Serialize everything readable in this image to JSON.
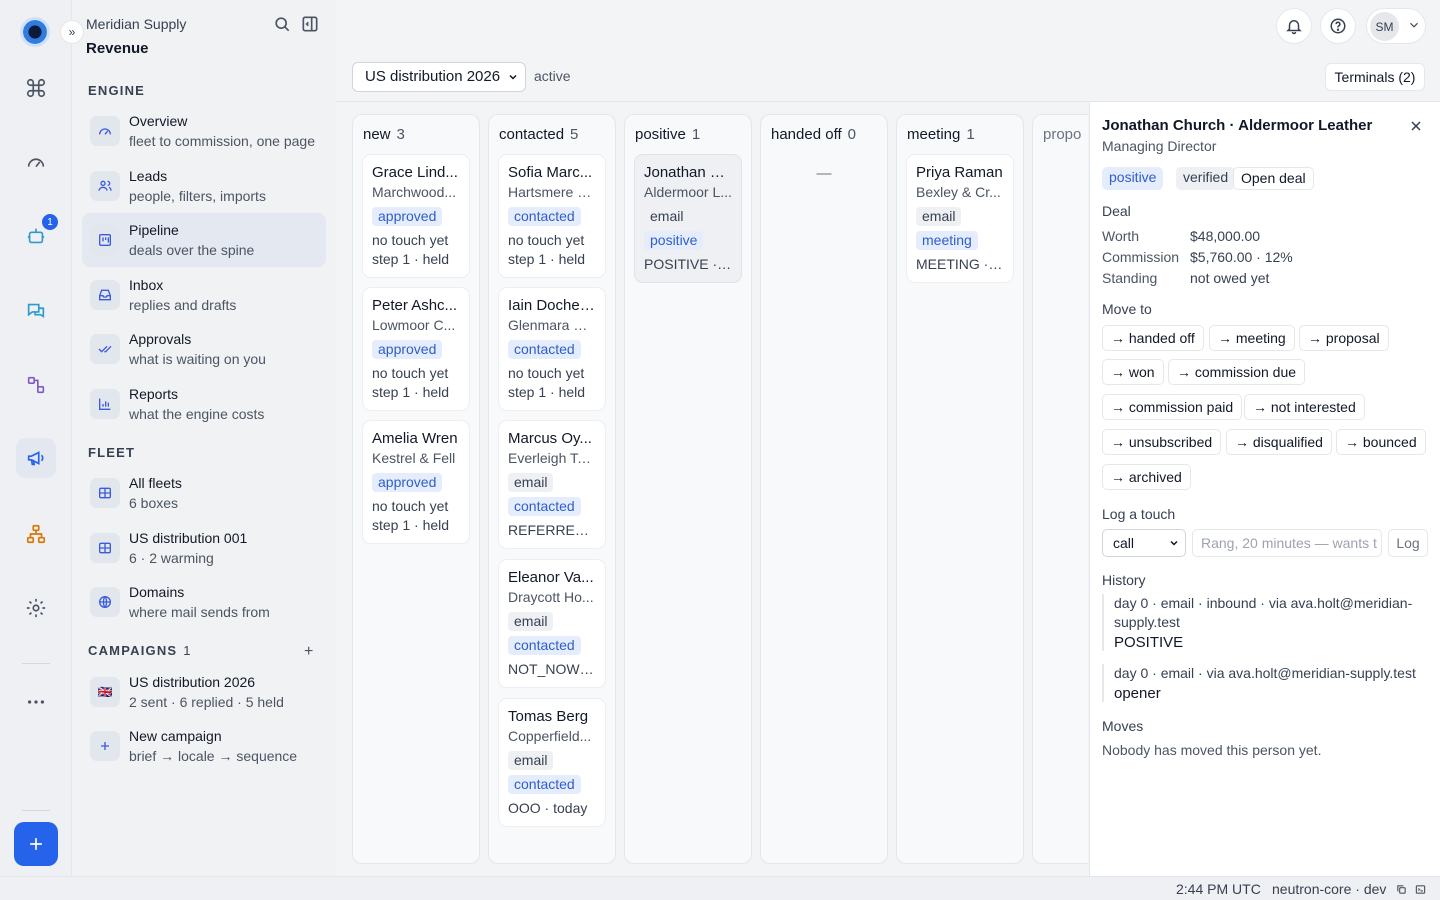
{
  "rail": {
    "inbox_badge": "1",
    "icons": [
      "command-icon",
      "gauge-icon",
      "bot-icon",
      "chat-icon",
      "flow-icon",
      "megaphone-icon",
      "org-chart-icon",
      "gear-icon",
      "more-icon"
    ]
  },
  "sidebar": {
    "org_name": "Meridian Supply",
    "section_title": "Revenue",
    "engine_heading": "ENGINE",
    "engine_items": [
      {
        "title": "Overview",
        "subtitle": "fleet to commission, one page"
      },
      {
        "title": "Leads",
        "subtitle": "people, filters, imports"
      },
      {
        "title": "Pipeline",
        "subtitle": "deals over the spine"
      },
      {
        "title": "Inbox",
        "subtitle": "replies and drafts"
      },
      {
        "title": "Approvals",
        "subtitle": "what is waiting on you"
      },
      {
        "title": "Reports",
        "subtitle": "what the engine costs"
      }
    ],
    "fleet_heading": "FLEET",
    "fleet_items": [
      {
        "title": "All fleets",
        "subtitle": "6 boxes"
      },
      {
        "title": "US distribution 001",
        "subtitle": "6 · 2 warming"
      },
      {
        "title": "Domains",
        "subtitle": "where mail sends from"
      }
    ],
    "campaigns_heading": "CAMPAIGNS",
    "campaigns_count": "1",
    "campaign_items": [
      {
        "title": "US distribution 2026",
        "subtitle": "2 sent · 6 replied · 5 held"
      },
      {
        "title": "New campaign",
        "subtitle": "brief → locale → sequence"
      }
    ]
  },
  "topbar": {
    "user_initials": "SM"
  },
  "campaign_bar": {
    "selected": "US distribution 2026",
    "status": "active",
    "terminals_label": "Terminals (2)"
  },
  "board": {
    "columns": [
      {
        "name": "new",
        "count": "3",
        "cards": [
          {
            "name": "Grace Lind...",
            "company": "Marchwood...",
            "tags": [
              "approved"
            ],
            "lines": [
              "no touch yet",
              "step 1 · held"
            ]
          },
          {
            "name": "Peter Ashc...",
            "company": "Lowmoor C...",
            "tags": [
              "approved"
            ],
            "lines": [
              "no touch yet",
              "step 1 · held"
            ]
          },
          {
            "name": "Amelia Wren",
            "company": "Kestrel & Fell",
            "tags": [
              "approved"
            ],
            "lines": [
              "no touch yet",
              "step 1 · held"
            ]
          }
        ]
      },
      {
        "name": "contacted",
        "count": "5",
        "cards": [
          {
            "name": "Sofia Marc...",
            "company": "Hartsmere S...",
            "tags": [
              "contacted"
            ],
            "lines": [
              "no touch yet",
              "step 1 · held"
            ]
          },
          {
            "name": "Iain Docherty",
            "company": "Glenmara W...",
            "tags": [
              "contacted"
            ],
            "lines": [
              "no touch yet",
              "step 1 · held"
            ]
          },
          {
            "name": "Marcus Oy...",
            "company": "Everleigh Te...",
            "tags": [
              "email",
              "contacted"
            ],
            "lines": [
              "REFERRED · ..."
            ]
          },
          {
            "name": "Eleanor Va...",
            "company": "Draycott Ho...",
            "tags": [
              "email",
              "contacted"
            ],
            "lines": [
              "NOT_NOW ·..."
            ]
          },
          {
            "name": "Tomas Berg",
            "company": "Copperfield...",
            "tags": [
              "email",
              "contacted"
            ],
            "lines": [
              "OOO · today"
            ]
          }
        ]
      },
      {
        "name": "positive",
        "count": "1",
        "cards": [
          {
            "name": "Jonathan C...",
            "company": "Aldermoor L...",
            "tags": [
              "email",
              "positive"
            ],
            "lines": [
              "POSITIVE · t..."
            ]
          }
        ]
      },
      {
        "name": "handed off",
        "count": "0",
        "empty": "—",
        "cards": []
      },
      {
        "name": "meeting",
        "count": "1",
        "cards": [
          {
            "name": "Priya Raman",
            "company": "Bexley & Cr...",
            "tags": [
              "email",
              "meeting"
            ],
            "lines": [
              "MEETING · t..."
            ]
          }
        ]
      },
      {
        "name": "propo",
        "count": "",
        "cards": []
      }
    ]
  },
  "detail": {
    "title": "Jonathan Church · Aldermoor Leather",
    "role": "Managing Director",
    "chips": [
      "positive",
      "verified"
    ],
    "open_deal_label": "Open deal",
    "deal_heading": "Deal",
    "deal": [
      {
        "k": "Worth",
        "v": "$48,000.00"
      },
      {
        "k": "Commission",
        "v": "$5,760.00 · 12%"
      },
      {
        "k": "Standing",
        "v": "not owed yet"
      }
    ],
    "move_heading": "Move to",
    "moves": [
      "→ handed off",
      "→ meeting",
      "→ proposal",
      "→ won",
      "→ commission due",
      "→ commission paid",
      "→ not interested",
      "→ unsubscribed",
      "→ disqualified",
      "→ bounced",
      "→ archived"
    ],
    "log_heading": "Log a touch",
    "log_type": "call",
    "log_placeholder": "Rang, 20 minutes — wants t",
    "log_button": "Log",
    "history_heading": "History",
    "history": [
      {
        "meta": "day 0 · email · inbound · via ava.holt@meridian-supply.test",
        "value": "POSITIVE"
      },
      {
        "meta": "day 0 · email · via ava.holt@meridian-supply.test",
        "value": "opener"
      }
    ],
    "moves_heading": "Moves",
    "moves_empty": "Nobody has moved this person yet."
  },
  "statusbar": {
    "time": "2:44 PM UTC",
    "env": "neutron-core · dev"
  }
}
